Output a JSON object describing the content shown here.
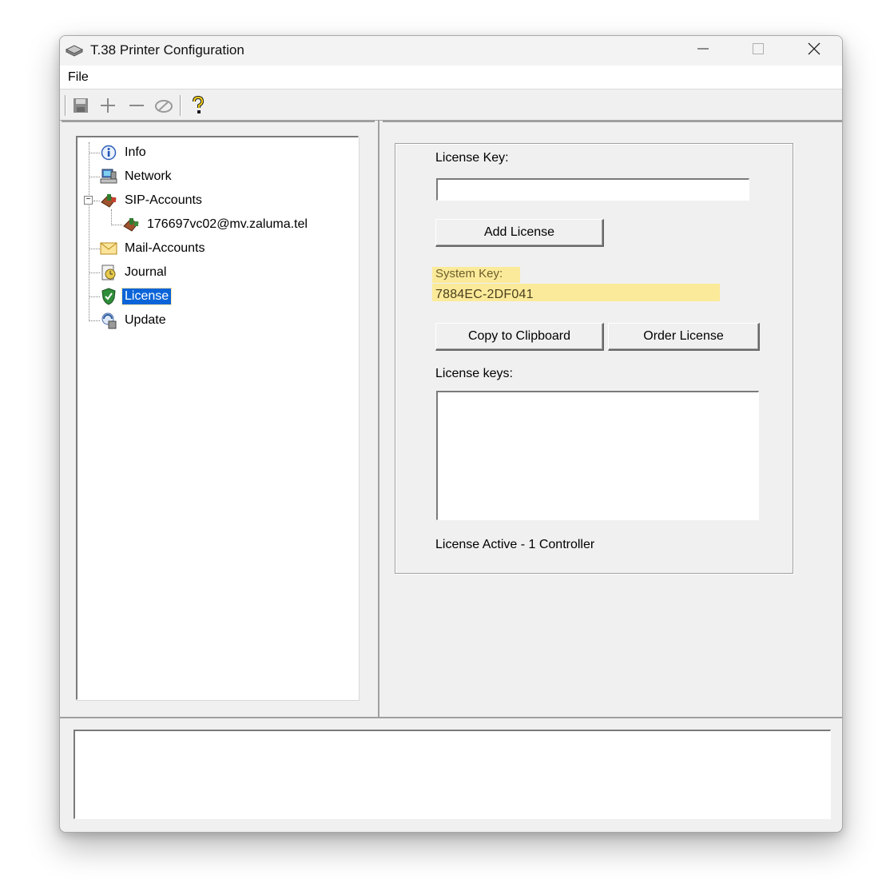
{
  "window": {
    "title": "T.38 Printer Configuration",
    "controls": {
      "minimize": "minimize-icon",
      "maximize": "maximize-icon",
      "close": "close-icon"
    }
  },
  "menu": {
    "file": "File"
  },
  "toolbar": {
    "buttons": [
      "save-icon",
      "add-icon",
      "remove-icon",
      "wrench-icon",
      "help-icon"
    ]
  },
  "tree": {
    "items": [
      {
        "label": "Info",
        "icon": "info-icon"
      },
      {
        "label": "Network",
        "icon": "network-icon"
      },
      {
        "label": "SIP-Accounts",
        "icon": "phone-icon",
        "expanded": true
      },
      {
        "label": "176697vc02@mv.zaluma.tel",
        "icon": "phone-account-icon"
      },
      {
        "label": "Mail-Accounts",
        "icon": "mail-icon"
      },
      {
        "label": "Journal",
        "icon": "journal-icon"
      },
      {
        "label": "License",
        "icon": "shield-icon",
        "selected": true
      },
      {
        "label": "Update",
        "icon": "update-icon"
      }
    ]
  },
  "license": {
    "license_key_label": "License Key:",
    "license_key_value": "",
    "add_license_label": "Add License",
    "system_key_label": "System Key:",
    "system_key_value": "7884EC-2DF041",
    "copy_label": "Copy to Clipboard",
    "order_label": "Order License",
    "license_keys_label": "License keys:",
    "status_text": "License Active - 1 Controller"
  },
  "colors": {
    "selection": "#0a64d8",
    "highlight": "#fde98a",
    "window_bg": "#f0f0f0"
  }
}
